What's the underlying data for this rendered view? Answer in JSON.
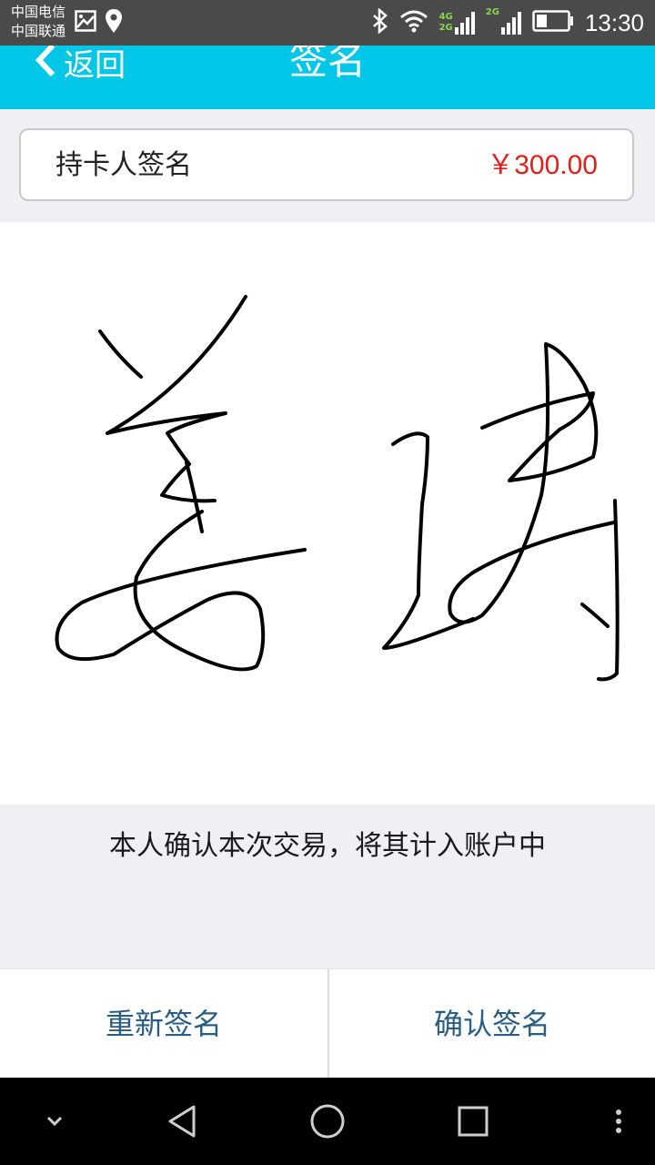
{
  "status_bar": {
    "carrier_1": "中国电信",
    "carrier_2": "中国联通",
    "net_1_top": "4G",
    "net_1_bottom": "2G",
    "net_2_top": "2G",
    "time": "13:30"
  },
  "app_bar": {
    "back_label": "返回",
    "title": "签名",
    "background_color": "#00c6e8"
  },
  "header": {
    "label": "持卡人签名",
    "amount": "￥300.00",
    "amount_color": "#e0201a"
  },
  "confirm_text": "本人确认本次交易，将其计入账户中",
  "buttons": {
    "resign_label": "重新签名",
    "confirm_label": "确认签名",
    "label_color": "#2a5d84"
  },
  "nav_bar": {
    "icons": [
      "chevron-down-icon",
      "back-triangle-icon",
      "home-circle-icon",
      "recents-square-icon",
      "more-vert-icon"
    ]
  }
}
